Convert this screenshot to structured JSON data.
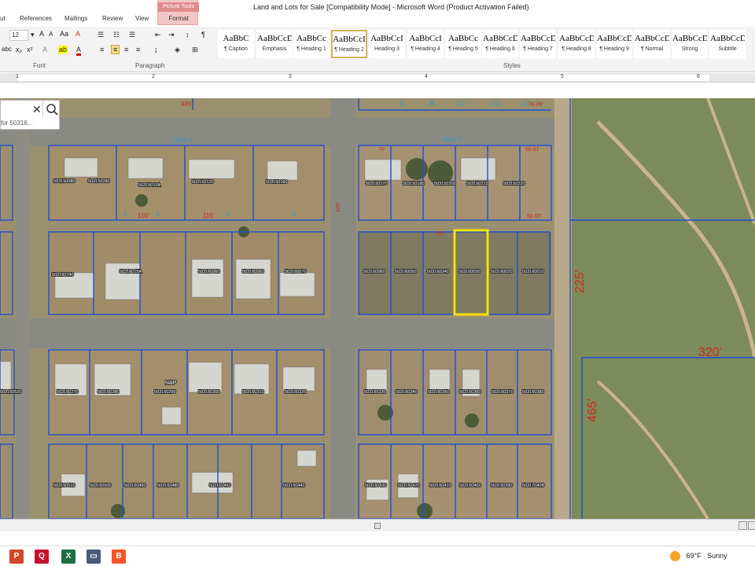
{
  "window": {
    "title": "Land and Lots for Sale [Compatibility Mode]  -  Microsoft Word (Product Activation Failed)"
  },
  "tabs": [
    "ut",
    "References",
    "Mailings",
    "Review",
    "View",
    "Format"
  ],
  "context_tab": {
    "group": "Picture Tools",
    "tab": "Format"
  },
  "ribbon": {
    "font_size": "12",
    "group_labels": {
      "font": "Font",
      "paragraph": "Paragraph",
      "styles": "Styles"
    },
    "styles": [
      {
        "sample": "AaBbC",
        "name": "¶ Caption"
      },
      {
        "sample": "AaBbCcDc",
        "name": "Emphasis"
      },
      {
        "sample": "AaBbCc",
        "name": "¶ Heading 1"
      },
      {
        "sample": "AaBbCcI",
        "name": "¶ Heading 2",
        "active": true
      },
      {
        "sample": "AaBbCcI",
        "name": "Heading 3"
      },
      {
        "sample": "AaBbCcI",
        "name": "¶ Heading 4"
      },
      {
        "sample": "AaBbCc",
        "name": "¶ Heading 5"
      },
      {
        "sample": "AaBbCcDc",
        "name": "¶ Heading 6"
      },
      {
        "sample": "AaBbCcDc",
        "name": "¶ Heading 7"
      },
      {
        "sample": "AaBbCcDc",
        "name": "¶ Heading 8"
      },
      {
        "sample": "AaBbCcDc",
        "name": "¶ Heading 9"
      },
      {
        "sample": "AaBbCcDc",
        "name": "¶ Normal"
      },
      {
        "sample": "AaBbCcDd",
        "name": "Strong"
      },
      {
        "sample": "AaBbCcD",
        "name": "Subtitle"
      }
    ]
  },
  "ruler_numbers": [
    "1",
    "2",
    "3",
    "4",
    "5",
    "6"
  ],
  "search": {
    "value": "for 50316..."
  },
  "map": {
    "block_labels": [
      "BLK 2",
      "BLK 3"
    ],
    "dimensions": [
      "445'",
      "225'",
      "320'",
      "465'",
      "150'",
      "115'",
      "110'",
      "120'",
      "50.61'",
      "50.65'",
      "78'",
      "76.88'"
    ],
    "parcel_numbers": [
      "503150080",
      "503150090",
      "50315010A",
      "503150120",
      "503150160",
      "503150170",
      "503150180",
      "503150200",
      "503150210",
      "503150220",
      "503160140",
      "50316015A",
      "503160060",
      "503160060",
      "503160070",
      "503160060",
      "503160050",
      "503160040",
      "503160030",
      "503160020",
      "503160010",
      "503160270",
      "503160280",
      "503160290",
      "503160300",
      "503160310",
      "503160320",
      "503160330",
      "503160340",
      "503160350",
      "503160360",
      "503160370",
      "503160380",
      "503160520",
      "503160510",
      "503160500",
      "503160490",
      "503160480",
      "503160450",
      "503160440",
      "503160430",
      "503160420",
      "503160410",
      "503160400",
      "503160390",
      "50317040B"
    ],
    "lot_numbers": [
      "3",
      "4",
      "5",
      "8",
      "6",
      "8",
      "9",
      "10",
      "11",
      "12"
    ],
    "other_labels": [
      "NAP"
    ],
    "highlight_color": "#f5e400",
    "line_color": "#1f4fd1",
    "dim_color": "#d42a1a"
  },
  "weather": {
    "temp": "69°F",
    "condition": "Sunny"
  },
  "taskbar_icons": [
    "powerpoint-icon",
    "quickbooks-icon",
    "excel-icon",
    "app-icon",
    "brave-icon"
  ]
}
